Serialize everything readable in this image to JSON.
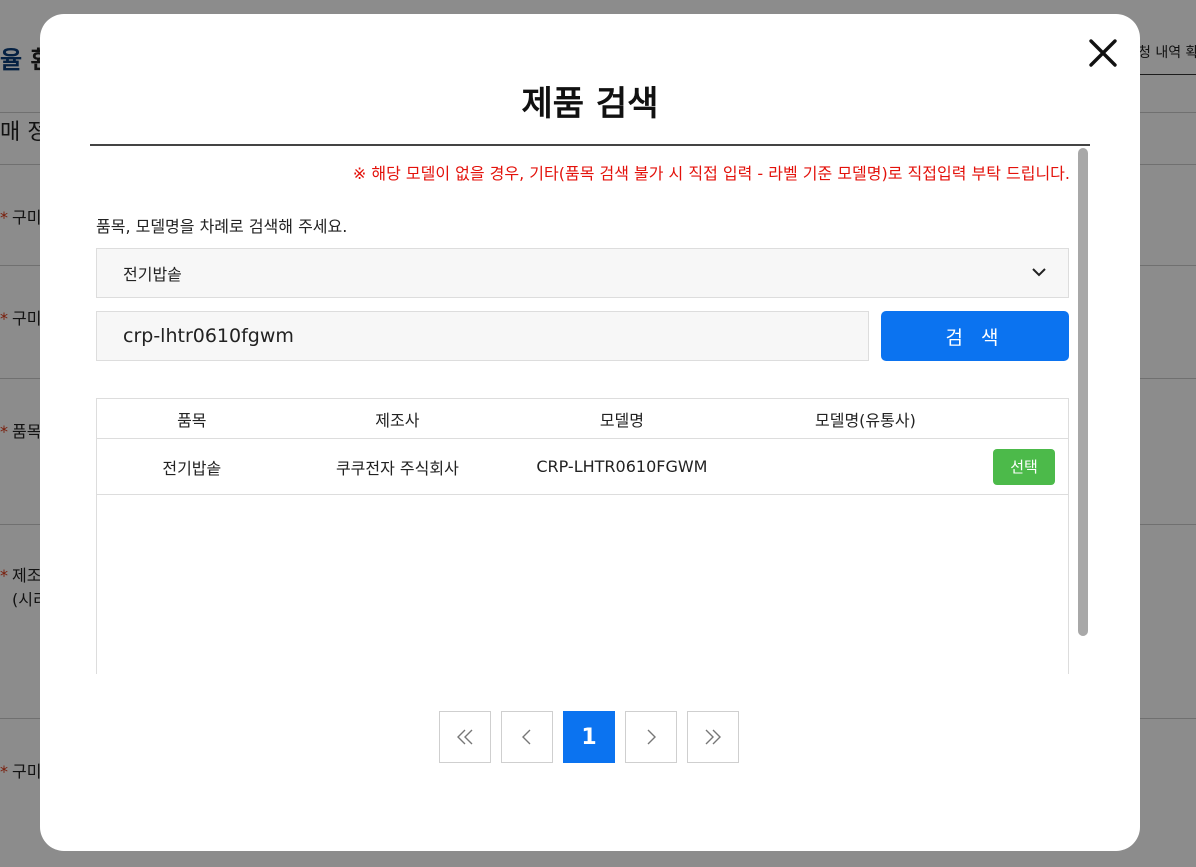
{
  "background": {
    "title_accent": "율",
    "title_rest": " 환",
    "right_link": "청 내역 확",
    "section": "매 정",
    "rows": [
      {
        "label": "구미"
      },
      {
        "label": "구미"
      },
      {
        "label": "품목"
      },
      {
        "label": "제조",
        "sub": "(시리"
      },
      {
        "label": "구미"
      }
    ]
  },
  "modal": {
    "title": "제품 검색",
    "notice": "※ 해당 모델이 없을 경우, 기타(품목 검색 불가 시 직접 입력 - 라벨 기준 모델명)로 직접입력 부탁 드립니다.",
    "instruction": "품목, 모델명을 차례로 검색해 주세요.",
    "category_select": {
      "value": "전기밥솥",
      "icon": "chevron-down-icon"
    },
    "search": {
      "value": "crp-lhtr0610fgwm",
      "button_label": "검 색"
    },
    "table": {
      "headers": [
        "품목",
        "제조사",
        "모델명",
        "모델명(유통사)"
      ],
      "rows": [
        {
          "item": "전기밥솥",
          "maker": "쿠쿠전자 주식회사",
          "model": "CRP-LHTR0610FGWM",
          "dist_model": "",
          "action": "선택"
        }
      ]
    },
    "pagination": {
      "current": "1"
    },
    "colors": {
      "primary": "#0b73f0",
      "select": "#4cba4a",
      "notice": "#e3120b"
    }
  }
}
